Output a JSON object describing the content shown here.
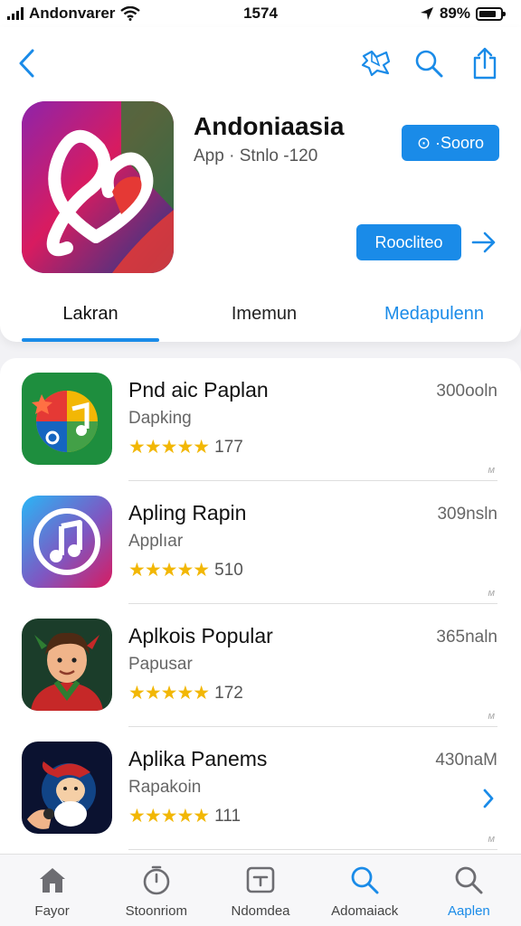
{
  "status_bar": {
    "carrier": "Andonvarer",
    "time": "1574",
    "battery": "89%"
  },
  "nav": {
    "icons": [
      "back-chevron-icon",
      "map-icon",
      "search-icon",
      "share-icon"
    ]
  },
  "app": {
    "title": "Andoniaasia",
    "subtitle": "App · Stnlo -120",
    "price_label": "⊙ ·Sooro",
    "action_label": "Roocliteo"
  },
  "tabs": [
    {
      "label": "Lakran"
    },
    {
      "label": "Imemun"
    },
    {
      "label": "Medapulenn"
    }
  ],
  "list": [
    {
      "title": "Pnd aic Paplan",
      "subtitle": "Dapking",
      "rating": "177",
      "size": "300ooln",
      "stars": 5
    },
    {
      "title": "Apling Rapin",
      "subtitle": "Applıar",
      "rating": "510",
      "size": "309nsln",
      "stars": 5
    },
    {
      "title": "Aplkois Popular",
      "subtitle": "Papusar",
      "rating": "172",
      "size": "365naln",
      "stars": 5
    },
    {
      "title": "Aplika Panems",
      "subtitle": "Rapakoin",
      "rating": "111",
      "size": "430naM",
      "stars": 5
    }
  ],
  "tab_bar": [
    {
      "label": "Fayor",
      "icon": "home-icon"
    },
    {
      "label": "Stoonriom",
      "icon": "timer-icon"
    },
    {
      "label": "Ndomdea",
      "icon": "tv-icon"
    },
    {
      "label": "Adomaiack",
      "icon": "search-icon"
    },
    {
      "label": "Aaplen",
      "icon": "search-icon"
    }
  ],
  "colors": {
    "accent": "#1a8be8",
    "star": "#f2b705"
  }
}
